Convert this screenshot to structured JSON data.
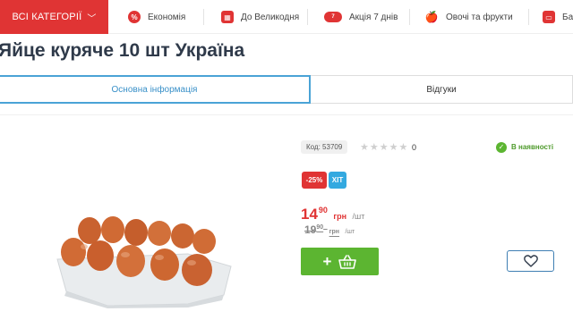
{
  "nav": {
    "all_categories": "ВСІ КАТЕГОРІЇ",
    "items": [
      {
        "label": "Економія",
        "icon": "percent-icon"
      },
      {
        "label": "До Великодня",
        "icon": "calendar-icon"
      },
      {
        "label": "Акція 7 днів",
        "icon": "promo-badge-icon"
      },
      {
        "label": "Овочі та фрукти",
        "icon": "fruit-icon"
      },
      {
        "label": "Ба",
        "icon": "bakery-icon"
      }
    ]
  },
  "product": {
    "title": "Яйце куряче 10 шт Україна",
    "code": "Код: 53709",
    "rating": 0,
    "rating_count": "0",
    "stock_status": "В наявності",
    "badges": {
      "discount": "-25%",
      "hit": "ХІТ"
    },
    "price": {
      "int": "14",
      "cents": "90",
      "currency": "грн",
      "unit": "/шт"
    },
    "old_price": {
      "int": "19",
      "cents": "90",
      "currency": "грн",
      "unit": "/шт"
    }
  },
  "tabs": {
    "main_info": "Основна інформація",
    "reviews": "Відгуки"
  },
  "colors": {
    "accent_red": "#e03434",
    "accent_blue": "#4aa3d6",
    "cart_green": "#5cb531"
  }
}
